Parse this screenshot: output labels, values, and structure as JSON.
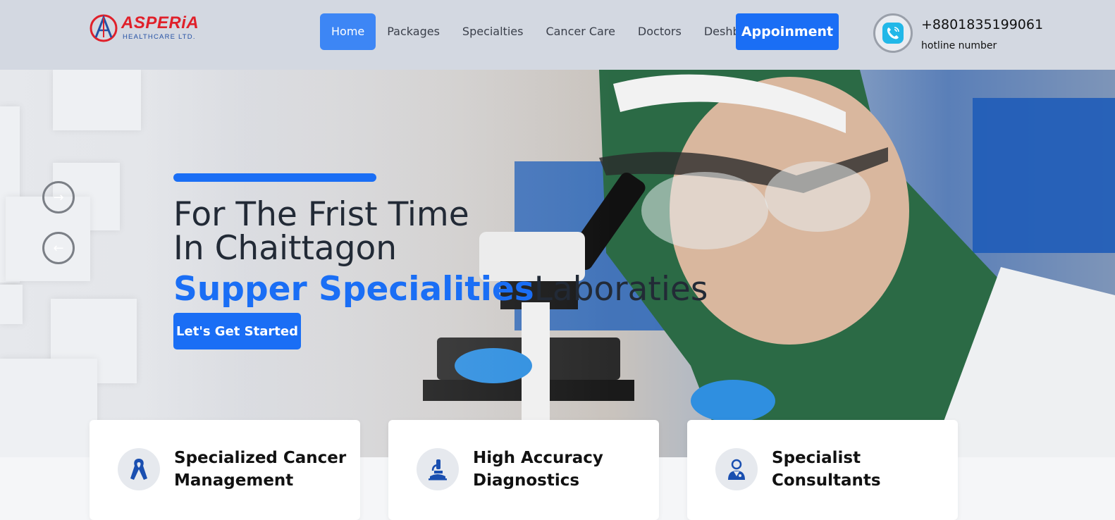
{
  "brand": {
    "name": "ASPERiA",
    "subtitle": "HEALTHCARE LTD."
  },
  "nav": {
    "items": [
      {
        "label": "Home",
        "active": true
      },
      {
        "label": "Packages"
      },
      {
        "label": "Specialties"
      },
      {
        "label": "Cancer Care"
      },
      {
        "label": "Doctors"
      },
      {
        "label": "Deshboard"
      }
    ],
    "appointment_label": "Appoinment"
  },
  "hotline": {
    "number": "+8801835199061",
    "label": "hotline number",
    "icon": "phone-icon"
  },
  "hero": {
    "line1": "For The Frist Time",
    "line2": "In Chaittagon",
    "line3_highlight": "Supper Specialities",
    "line3_rest": "Laboraties",
    "cta_label": "Let's Get Started",
    "next_icon": "arrow-right-icon",
    "prev_icon": "arrow-left-icon"
  },
  "features": [
    {
      "title": "Specialized Cancer Management",
      "icon": "ribbon-icon"
    },
    {
      "title": "High Accuracy Diagnostics",
      "icon": "microscope-icon"
    },
    {
      "title": "Specialist Consultants",
      "icon": "doctor-icon"
    }
  ],
  "colors": {
    "primary": "#1a6ef5",
    "brand_red": "#e0202a",
    "brand_blue": "#2451a4",
    "header_bg": "#d3d8e1"
  }
}
